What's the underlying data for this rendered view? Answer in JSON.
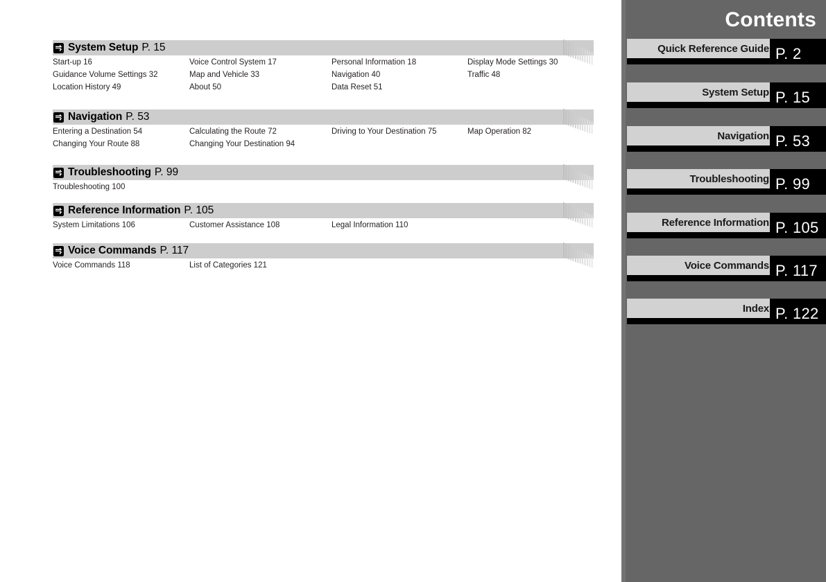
{
  "sidebar": {
    "title": "Contents",
    "tabs": [
      {
        "label": "Quick Reference Guide",
        "page": "P. 2"
      },
      {
        "label": "System Setup",
        "page": "P. 15"
      },
      {
        "label": "Navigation",
        "page": "P. 53"
      },
      {
        "label": "Troubleshooting",
        "page": "P. 99"
      },
      {
        "label": "Reference Information",
        "page": "P. 105"
      },
      {
        "label": "Voice Commands",
        "page": "P. 117"
      },
      {
        "label": "Index",
        "page": "P. 122"
      }
    ]
  },
  "toc": {
    "sections": [
      {
        "icon": "arrow-right-icon",
        "title": "System Setup",
        "page": "P. 15",
        "rows": [
          [
            "Start-up 16",
            "Voice Control System 17",
            "Personal Information 18",
            "Display Mode Settings 30"
          ],
          [
            "Guidance Volume Settings 32",
            "Map and Vehicle 33",
            "Navigation 40",
            "Traffic 48"
          ],
          [
            "Location History 49",
            "About 50",
            "Data Reset 51",
            ""
          ]
        ]
      },
      {
        "icon": "arrow-right-icon",
        "title": "Navigation",
        "page": "P. 53",
        "rows": [
          [
            "Entering a Destination 54",
            "Calculating the Route 72",
            "Driving to Your Destination 75",
            "Map Operation 82"
          ],
          [
            "Changing Your Route 88",
            "Changing Your Destination 94",
            "",
            ""
          ]
        ]
      },
      {
        "icon": "arrow-right-icon",
        "title": "Troubleshooting",
        "page": "P. 99",
        "rows": [
          [
            "Troubleshooting 100",
            "",
            "",
            ""
          ]
        ]
      },
      {
        "icon": "arrow-right-icon",
        "title": "Reference Information",
        "page": "P. 105",
        "rows": [
          [
            "System Limitations 106",
            "Customer Assistance 108",
            "Legal Information 110",
            ""
          ]
        ]
      },
      {
        "icon": "arrow-right-icon",
        "title": "Voice Commands",
        "page": "P. 117",
        "rows": [
          [
            "Voice Commands 118",
            "List of Categories 121",
            "",
            ""
          ]
        ]
      }
    ]
  },
  "colors": {
    "section_bar": "#cdcdcd",
    "sidebar_bg": "#666666",
    "tab_strip": "#d2d2d2",
    "tab_page_box": "#000000",
    "text": "#231f20"
  }
}
